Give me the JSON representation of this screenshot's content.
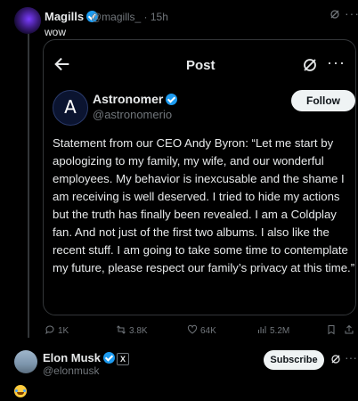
{
  "top_tweet": {
    "name": "Magills",
    "handle_time": "@magills_ · 15h",
    "text": "wow"
  },
  "embedded_post": {
    "header_title": "Post",
    "account_name": "Astronomer",
    "account_handle": "@astronomerio",
    "avatar_letter": "A",
    "follow_label": "Follow",
    "statement": "Statement from our CEO Andy Byron: “Let me start by apologizing to my family, my wife, and our wonderful employees. My behavior is inexcusable and the shame I am receiving is well deserved. I tried to hide my actions but the truth has finally been revealed. I am a Coldplay fan. And not just of the first two albums. I also like the recent stuff. I am going to take some time to contemplate my future, please respect our family’s privacy at this time.”"
  },
  "actions": {
    "replies": "1K",
    "reposts": "3.8K",
    "likes": "64K",
    "views": "5.2M"
  },
  "reply": {
    "name": "Elon Musk",
    "badge": "X",
    "handle": "@elonmusk",
    "subscribe_label": "Subscribe"
  },
  "icons": {
    "verified": "verified-badge-icon",
    "grok": "grok-icon",
    "more": "more-icon",
    "back": "back-arrow-icon",
    "reply": "reply-icon",
    "repost": "repost-icon",
    "like": "like-icon",
    "views": "views-icon",
    "bookmark": "bookmark-icon",
    "share": "share-icon",
    "emoji": "laughing-tears-emoji-icon"
  },
  "colors": {
    "background": "#000000",
    "text": "#e7e9ea",
    "muted": "#71767b",
    "verified_blue": "#1d9bf0",
    "border": "#333639"
  }
}
